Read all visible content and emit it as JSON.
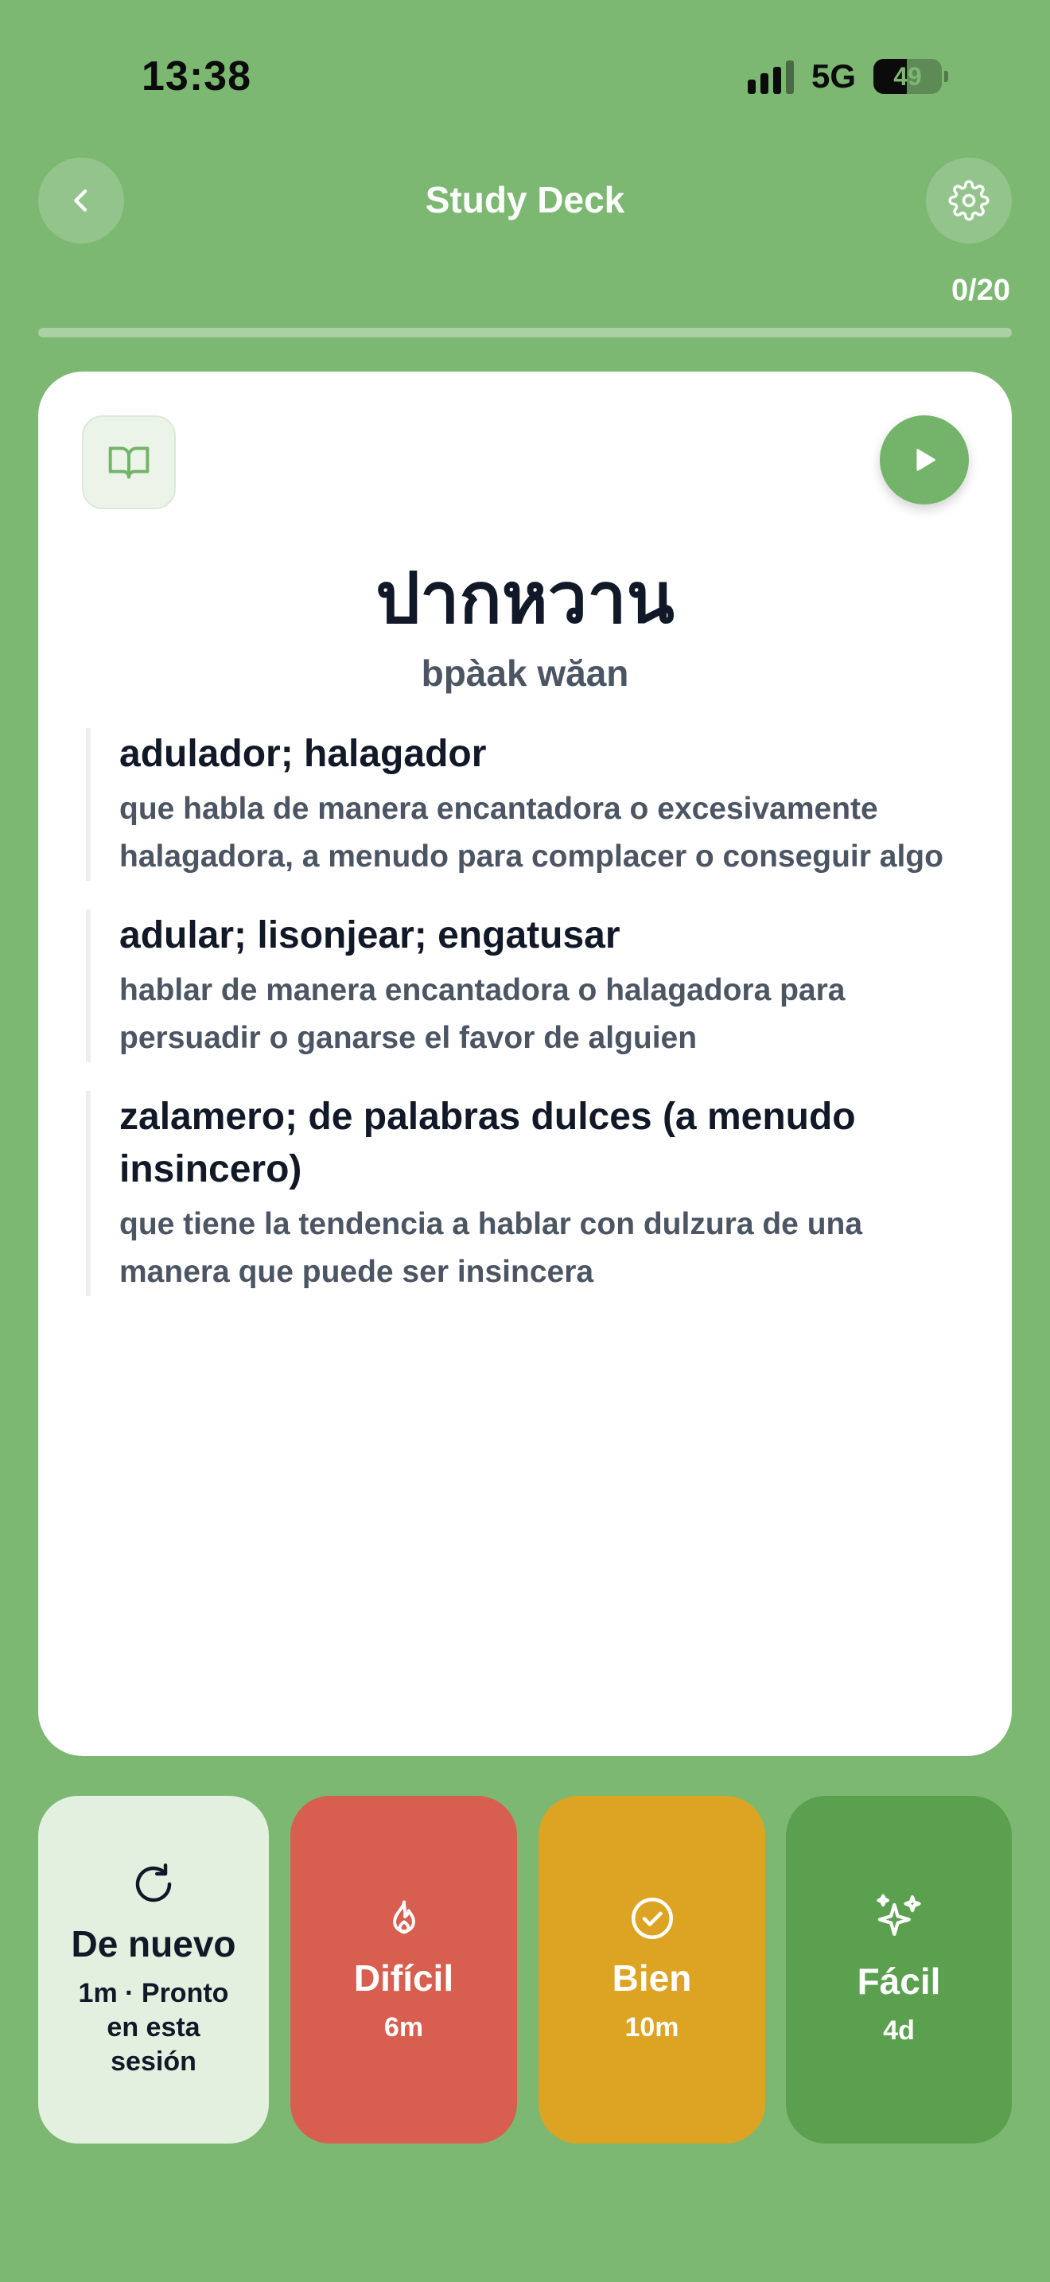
{
  "status_bar": {
    "time": "13:38",
    "network": "5G",
    "battery": "49"
  },
  "header": {
    "title": "Study Deck",
    "back_icon": "chevron-left-icon",
    "settings_icon": "gear-icon"
  },
  "progress": {
    "label": "0/20",
    "completed": 0,
    "total": 20
  },
  "card": {
    "word": "ปากหวาน",
    "romanization": "bpàak wăan",
    "book_icon": "open-book-icon",
    "play_icon": "play-icon",
    "definitions": [
      {
        "title": "adulador; halagador",
        "description": "que habla de manera encantadora o excesivamente halagadora, a menudo para complacer o conseguir algo"
      },
      {
        "title": "adular; lisonjear; engatusar",
        "description": "hablar de manera encantadora o halagadora para persuadir o ganarse el favor de alguien"
      },
      {
        "title": "zalamero; de palabras dulces (a menudo insincero)",
        "description": "que tiene la tendencia a hablar con dulzura de una manera que puede ser insincera"
      }
    ]
  },
  "ratings": [
    {
      "label": "De nuevo",
      "time": "1m · Pronto en esta sesión",
      "icon": "refresh-icon",
      "color": "#e3f0df"
    },
    {
      "label": "Difícil",
      "time": "6m",
      "icon": "flame-icon",
      "color": "#d85f4f"
    },
    {
      "label": "Bien",
      "time": "10m",
      "icon": "check-circle-icon",
      "color": "#dca422"
    },
    {
      "label": "Fácil",
      "time": "4d",
      "icon": "sparkles-icon",
      "color": "#5aa04e"
    }
  ],
  "colors": {
    "background": "#7cb872",
    "accent": "#74b46a"
  }
}
